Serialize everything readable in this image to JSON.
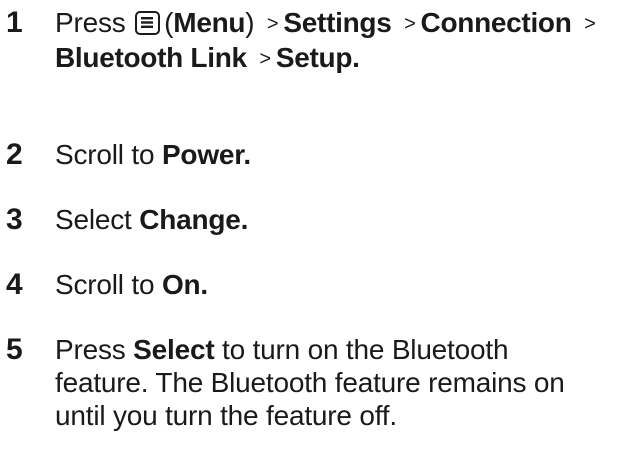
{
  "steps": [
    {
      "number": "1",
      "text_press": "Press",
      "menu_icon": "menu-key-icon",
      "menu_open_paren": "(",
      "menu_label": "Menu",
      "menu_close_paren": ")",
      "separator": ">",
      "path": [
        "Settings",
        "Connection",
        "Bluetooth Link",
        "Setup."
      ]
    },
    {
      "number": "2",
      "text": "Scroll to ",
      "bold": "Power."
    },
    {
      "number": "3",
      "text": "Select ",
      "bold": "Change."
    },
    {
      "number": "4",
      "text": "Scroll to ",
      "bold": "On."
    },
    {
      "number": "5",
      "text_before": "Press ",
      "bold": "Select",
      "line1_rest": " to turn on the Bluetooth",
      "line2": "feature. The Bluetooth feature remains on",
      "line3": "until you turn the feature off."
    }
  ]
}
